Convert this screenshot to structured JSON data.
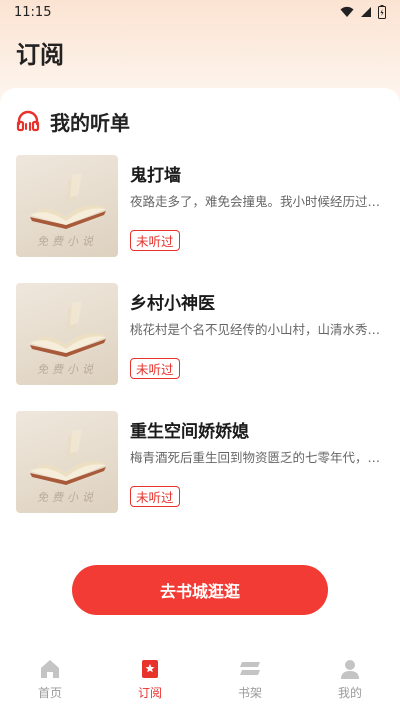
{
  "status_bar": {
    "time": "11:15"
  },
  "header": {
    "title": "订阅"
  },
  "section": {
    "title": "我的听单"
  },
  "books": [
    {
      "title": "鬼打墙",
      "desc": "夜路走多了，难免会撞鬼。我小时候经历过…",
      "badge": "未听过",
      "cover_text": "免费小说"
    },
    {
      "title": "乡村小神医",
      "desc": "桃花村是个名不见经传的小山村，山清水秀…",
      "badge": "未听过",
      "cover_text": "免费小说"
    },
    {
      "title": "重生空间娇娇媳",
      "desc": "梅青酒死后重生回到物资匮乏的七零年代，…",
      "badge": "未听过",
      "cover_text": "免费小说"
    }
  ],
  "cta": {
    "label": "去书城逛逛"
  },
  "tabbar": {
    "tabs": [
      {
        "label": "首页",
        "icon": "home-icon"
      },
      {
        "label": "订阅",
        "icon": "bookmark-icon",
        "active": true
      },
      {
        "label": "书架",
        "icon": "bookshelf-icon"
      },
      {
        "label": "我的",
        "icon": "person-icon"
      }
    ]
  },
  "colors": {
    "accent": "#e8322c",
    "cta": "#f23b34",
    "inactive": "#9a9a9a"
  }
}
